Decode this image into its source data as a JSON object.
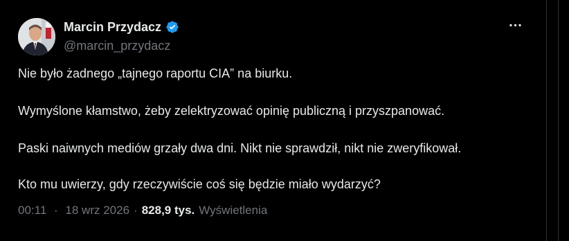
{
  "author": {
    "display_name": "Marcin Przydacz",
    "handle": "@marcin_przydacz",
    "verified_icon": "verified-badge-icon"
  },
  "tweet": {
    "paragraphs": [
      "Nie było żadnego „tajnego raportu CIA” na biurku.",
      "Wymyślone kłamstwo, żeby zelektryzować opinię publiczną i przyszpanować.",
      "Paski naiwnych mediów grzały dwa dni. Nikt nie sprawdził, nikt nie zweryfikował.",
      "Kto mu uwierzy, gdy rzeczywiście coś się będzie miało wydarzyć?"
    ],
    "time": "00:11",
    "date": "18 wrz 2026",
    "separator": "·",
    "views_count": "828,9 tys.",
    "views_label": "Wyświetlenia"
  },
  "menu": {
    "more_label": "..."
  },
  "colors": {
    "background": "#000000",
    "text": "#e7e9ea",
    "secondary": "#71767b",
    "verified": "#1d9bf0",
    "border": "#2f3336"
  }
}
